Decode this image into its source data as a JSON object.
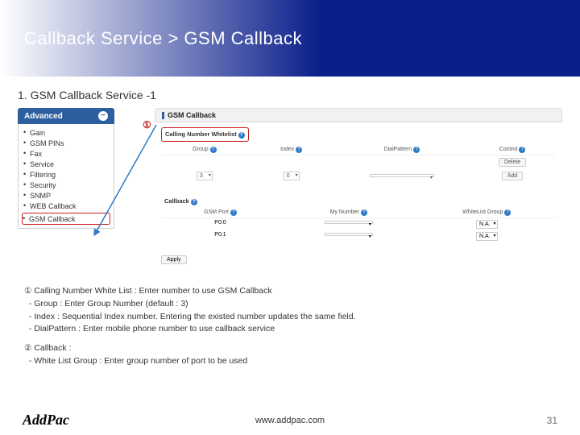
{
  "header": {
    "title": "Callback Service > GSM Callback"
  },
  "subhead": "1. GSM Callback Service -1",
  "sidebar": {
    "title": "Advanced",
    "items": [
      "Gain",
      "GSM PINs",
      "Fax",
      "Service",
      "Filtering",
      "Security",
      "SNMP",
      "WEB Callback",
      "GSM Callback"
    ]
  },
  "panel": {
    "title": "GSM Callback",
    "whitelist": {
      "section": "Calling Number Whitelist",
      "cols": {
        "group": "Group",
        "index": "Index",
        "dial": "DialPattern",
        "control": "Control"
      },
      "groupVal": "3",
      "indexVal": "0",
      "buttons": {
        "delete": "Delete",
        "add": "Add"
      }
    },
    "callback": {
      "section": "Callback",
      "cols": {
        "port": "GSM Port",
        "myNumber": "My Number",
        "wlg": "WhiteList Group"
      },
      "rows": [
        {
          "port": "P0:0",
          "myNumber": "",
          "wlg": "N.A."
        },
        {
          "port": "P0:1",
          "myNumber": "",
          "wlg": "N.A."
        }
      ]
    },
    "apply": "Apply"
  },
  "callouts": {
    "c1": "①"
  },
  "explain": {
    "l1": "① Calling Number White List : Enter number to use GSM Callback",
    "l2": "- Group : Enter Group Number (default : 3)",
    "l3": "- Index : Sequential Index number. Entering the existed number updates the same field.",
    "l4": "- DialPattern : Enter mobile phone number to use callback service",
    "l5": "② Callback :",
    "l6": "- White List Group : Enter group number of port to be used"
  },
  "footer": {
    "logo": "AddPac",
    "site": "www.addpac.com",
    "page": "31"
  }
}
